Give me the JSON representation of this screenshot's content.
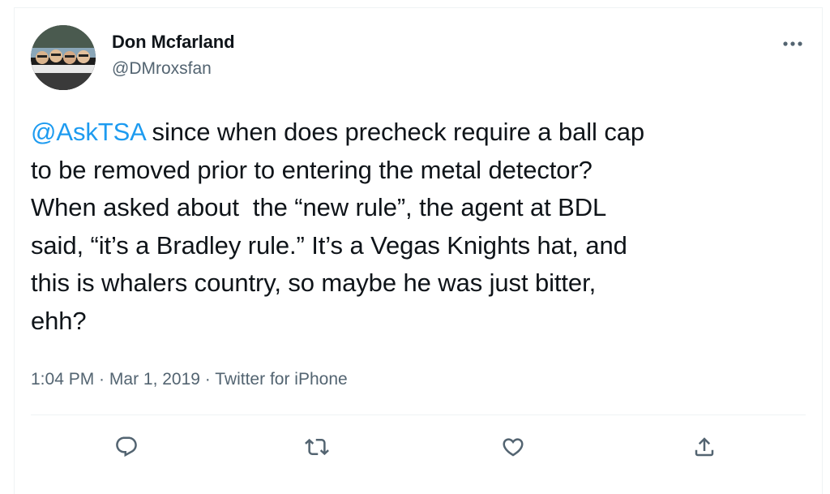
{
  "tweet": {
    "author": {
      "display_name": "Don Mcfarland",
      "handle": "@DMroxsfan"
    },
    "mention": "@AskTSA",
    "text_after_mention": " since when does precheck require a ball cap\nto be removed prior to entering the metal detector?\nWhen asked about  the “new rule”, the agent at BDL\nsaid, “it’s a Bradley rule.” It’s a Vegas Knights hat, and\nthis is whalers country, so maybe he was just bitter,\nehh?",
    "time": "1:04 PM",
    "separator": " · ",
    "date": "Mar 1, 2019",
    "source": "Twitter for iPhone"
  },
  "icons": {
    "more": "more-horizontal-icon",
    "reply": "reply-bubble-icon",
    "retweet": "retweet-icon",
    "like": "heart-icon",
    "share": "share-upload-icon"
  },
  "colors": {
    "text": "#0f1419",
    "secondary": "#536471",
    "link": "#1d9bf0",
    "border": "#eff3f4"
  }
}
